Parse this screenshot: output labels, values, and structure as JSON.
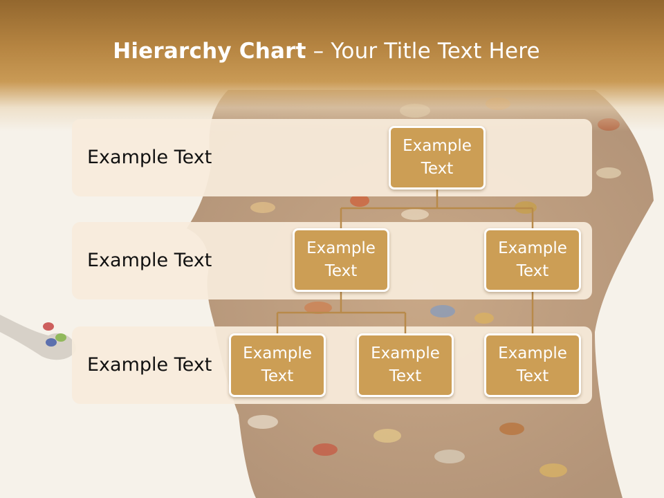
{
  "slide": {
    "title_bold": "Hierarchy Chart",
    "title_rest": " – Your Title Text Here"
  },
  "levels": [
    {
      "label": "Example Text"
    },
    {
      "label": "Example Text"
    },
    {
      "label": "Example Text"
    }
  ],
  "nodes": {
    "root": "Example Text",
    "mid_left": "Example Text",
    "mid_right": "Example Text",
    "bottom_left": "Example Text",
    "bottom_middle": "Example Text",
    "bottom_right": "Example Text"
  },
  "colors": {
    "header": "#b58441",
    "node_fill": "#cc9e55",
    "connector": "#b88a4a",
    "band": "#f7ecdb"
  }
}
